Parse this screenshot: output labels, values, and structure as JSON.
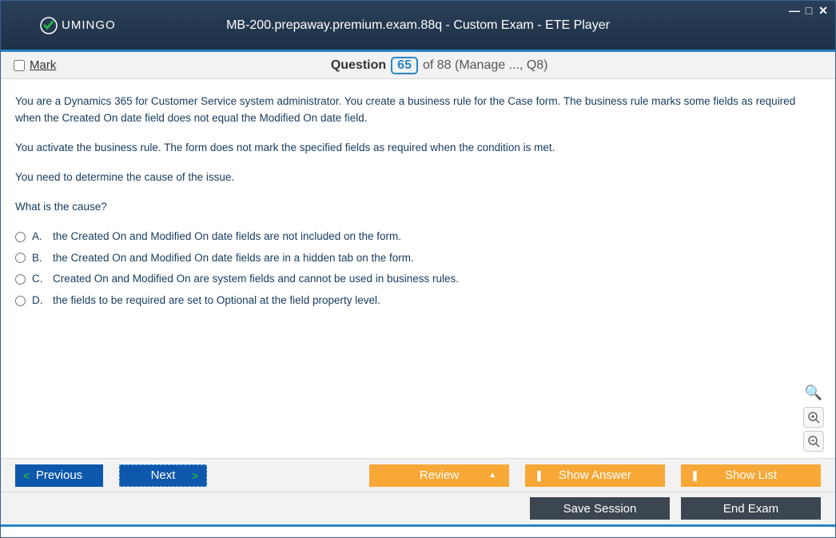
{
  "header": {
    "logo_text": "UMINGO",
    "title": "MB-200.prepaway.premium.exam.88q - Custom Exam - ETE Player"
  },
  "question_bar": {
    "mark_label": "Mark",
    "question_label": "Question",
    "current": "65",
    "rest": "of 88 (Manage ..., Q8)"
  },
  "question": {
    "para1": "You are a Dynamics 365 for Customer Service system administrator. You create a business rule for the Case form. The business rule marks some fields as required when the Created On date field does not equal the Modified On date field.",
    "para2": "You activate the business rule. The form does not mark the specified fields as required when the condition is met.",
    "para3": "You need to determine the cause of the issue.",
    "para4": "What is the cause?",
    "options": [
      {
        "letter": "A.",
        "text": "the Created On and Modified On date fields are not included on the form."
      },
      {
        "letter": "B.",
        "text": "the Created On and Modified On date fields are in a hidden tab on the form."
      },
      {
        "letter": "C.",
        "text": "Created On and Modified On are system fields and cannot be used in business rules."
      },
      {
        "letter": "D.",
        "text": "the fields to be required are set to Optional at the field property level."
      }
    ]
  },
  "footer": {
    "previous": "Previous",
    "next": "Next",
    "review": "Review",
    "show_answer": "Show Answer",
    "show_list": "Show List",
    "save_session": "Save Session",
    "end_exam": "End Exam"
  }
}
